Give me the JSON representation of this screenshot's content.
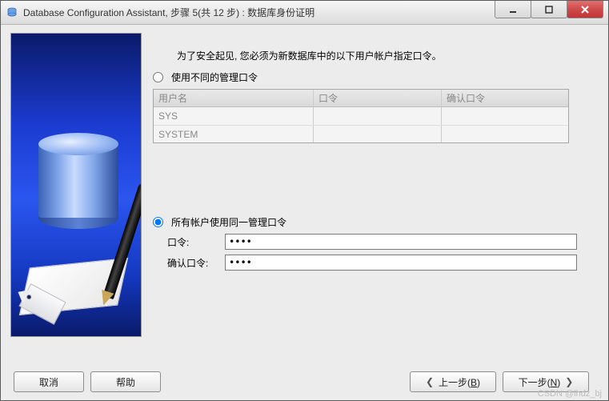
{
  "window": {
    "title": "Database Configuration Assistant, 步骤 5(共 12 步) : 数据库身份证明"
  },
  "intro": "为了安全起见, 您必须为新数据库中的以下用户帐户指定口令。",
  "options": {
    "different": {
      "label": "使用不同的管理口令",
      "selected": false
    },
    "same": {
      "label": "所有帐户使用同一管理口令",
      "selected": true
    }
  },
  "table": {
    "headers": {
      "user": "用户名",
      "password": "口令",
      "confirm": "确认口令"
    },
    "rows": [
      {
        "user": "SYS",
        "password": "",
        "confirm": ""
      },
      {
        "user": "SYSTEM",
        "password": "",
        "confirm": ""
      }
    ]
  },
  "fields": {
    "password": {
      "label": "口令:",
      "value": "****"
    },
    "confirm": {
      "label": "确认口令:",
      "value": "****"
    }
  },
  "buttons": {
    "cancel": "取消",
    "help": "帮助",
    "back_prefix": "上一步(",
    "back_key": "B",
    "back_suffix": ")",
    "next_prefix": "下一步(",
    "next_key": "N",
    "next_suffix": ")"
  },
  "watermark": "CSDN @lhdz_bj"
}
